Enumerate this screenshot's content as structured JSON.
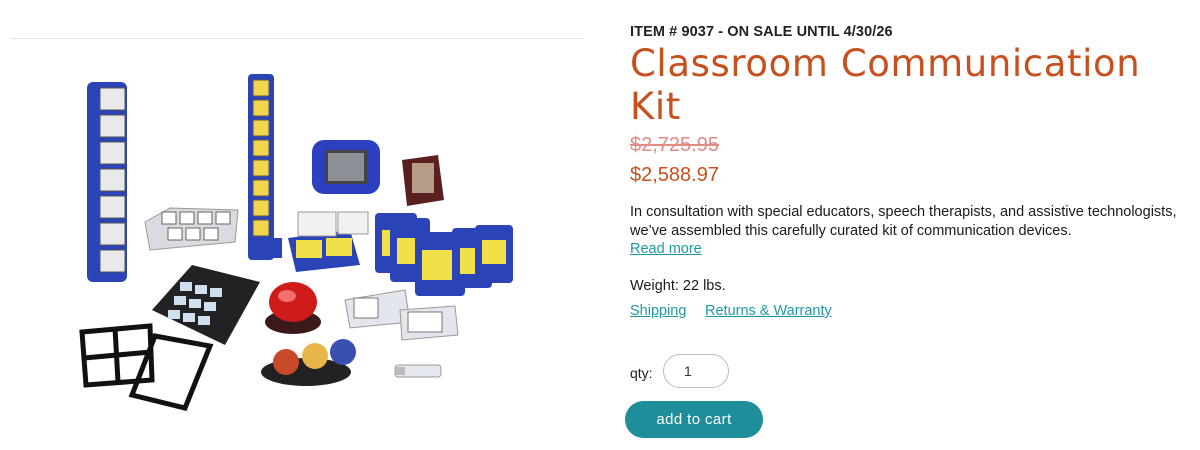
{
  "product": {
    "item_line": "ITEM # 9037 - ON SALE UNTIL 4/30/26",
    "title": "Classroom Communication Kit",
    "price_original": "$2,725.95",
    "price_sale": "$2,588.97",
    "description": "In consultation with special educators, speech therapists, and assistive technologists, we’ve assembled this carefully curated kit of communication devices.",
    "read_more_label": "Read more",
    "weight": "Weight: 22 lbs.",
    "shipping_label": "Shipping",
    "returns_label": "Returns & Warranty"
  },
  "cart": {
    "qty_label": "qty:",
    "qty_value": "1",
    "add_to_cart_label": "add to cart"
  },
  "colors": {
    "title": "#c8501f",
    "old_price": "#e18b84",
    "link": "#1f9aa5",
    "button": "#1e8e9b"
  }
}
